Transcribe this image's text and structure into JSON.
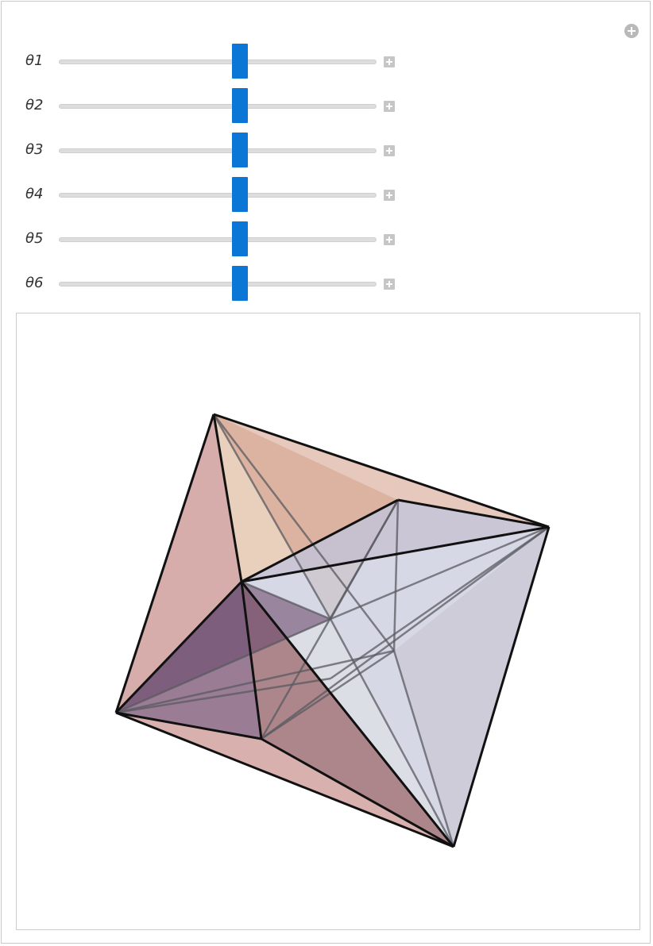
{
  "controls": {
    "sliders": [
      {
        "label": "θ1",
        "value_fraction": 0.5
      },
      {
        "label": "θ2",
        "value_fraction": 0.5
      },
      {
        "label": "θ3",
        "value_fraction": 0.5
      },
      {
        "label": "θ4",
        "value_fraction": 0.5
      },
      {
        "label": "θ5",
        "value_fraction": 0.5
      },
      {
        "label": "θ6",
        "value_fraction": 0.5
      }
    ]
  },
  "colors": {
    "slider_thumb": "#0a76d6",
    "slider_track": "#dddddd",
    "face_warm": "#d8a9a6",
    "face_purple": "#6d4a6e",
    "face_blue": "#aeb6d4",
    "edge": "#111111"
  },
  "icons": {
    "corner": "plus-circle-icon",
    "slider_expand": "plus-square-icon"
  }
}
